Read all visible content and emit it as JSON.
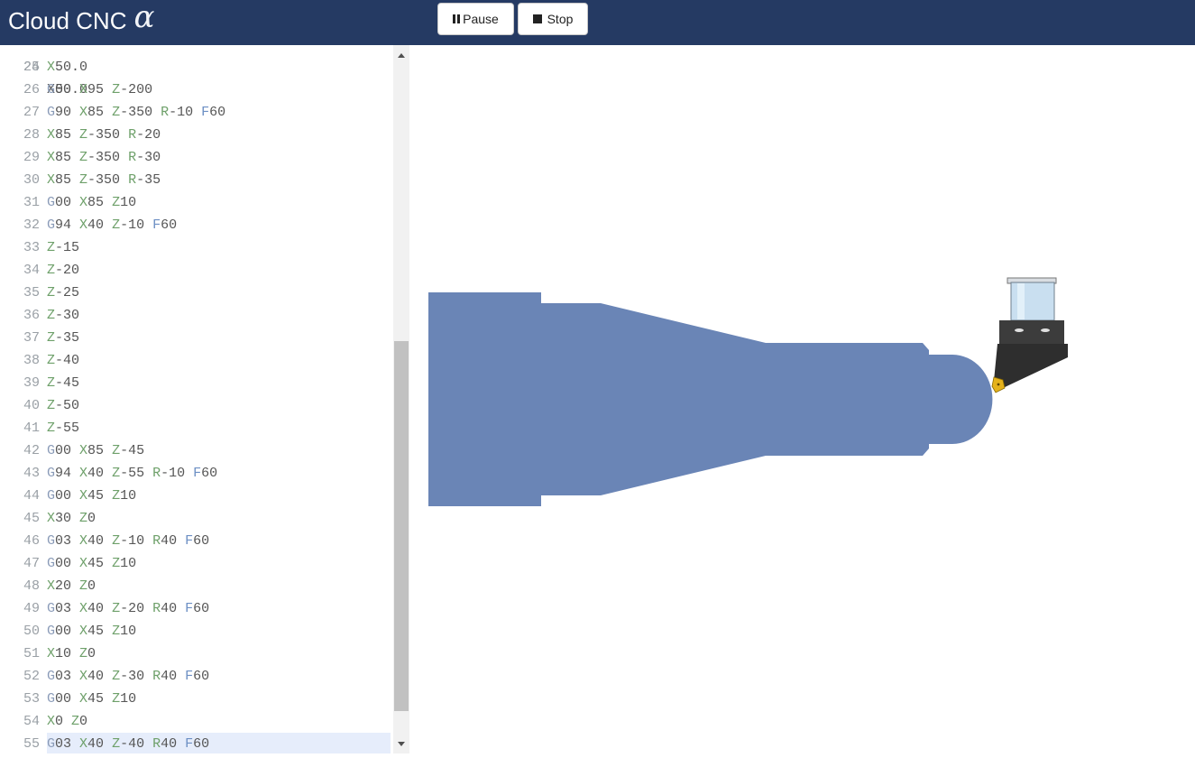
{
  "app": {
    "title": "Cloud CNC",
    "title_glyph": "α",
    "pause_label": "Pause",
    "stop_label": "Stop",
    "pause_icon": "pause-icon",
    "stop_icon": "stop-icon"
  },
  "colors": {
    "topbar": "#253a63",
    "workpiece": "#6a85b6",
    "active_line": "#e6edfb",
    "insert": "#e5b21c"
  },
  "editor": {
    "partial_top_line": {
      "num": "24",
      "text": "X50.0"
    },
    "active_line": "55",
    "lines": [
      {
        "num": "25",
        "tokens": [
          {
            "t": "X",
            "c": "x"
          },
          {
            "t": "50.0",
            "c": "n"
          }
        ]
      },
      {
        "num": "26",
        "tokens": [
          {
            "t": "G",
            "c": "g"
          },
          {
            "t": "00 ",
            "c": "n"
          },
          {
            "t": "X",
            "c": "x"
          },
          {
            "t": "95 ",
            "c": "n"
          },
          {
            "t": "Z",
            "c": "z"
          },
          {
            "t": "-200",
            "c": "n"
          }
        ]
      },
      {
        "num": "27",
        "tokens": [
          {
            "t": "G",
            "c": "g"
          },
          {
            "t": "90 ",
            "c": "n"
          },
          {
            "t": "X",
            "c": "x"
          },
          {
            "t": "85 ",
            "c": "n"
          },
          {
            "t": "Z",
            "c": "z"
          },
          {
            "t": "-350 ",
            "c": "n"
          },
          {
            "t": "R",
            "c": "r"
          },
          {
            "t": "-10 ",
            "c": "n"
          },
          {
            "t": "F",
            "c": "f"
          },
          {
            "t": "60",
            "c": "n"
          }
        ]
      },
      {
        "num": "28",
        "tokens": [
          {
            "t": "X",
            "c": "x"
          },
          {
            "t": "85 ",
            "c": "n"
          },
          {
            "t": "Z",
            "c": "z"
          },
          {
            "t": "-350 ",
            "c": "n"
          },
          {
            "t": "R",
            "c": "r"
          },
          {
            "t": "-20",
            "c": "n"
          }
        ]
      },
      {
        "num": "29",
        "tokens": [
          {
            "t": "X",
            "c": "x"
          },
          {
            "t": "85 ",
            "c": "n"
          },
          {
            "t": "Z",
            "c": "z"
          },
          {
            "t": "-350 ",
            "c": "n"
          },
          {
            "t": "R",
            "c": "r"
          },
          {
            "t": "-30",
            "c": "n"
          }
        ]
      },
      {
        "num": "30",
        "tokens": [
          {
            "t": "X",
            "c": "x"
          },
          {
            "t": "85 ",
            "c": "n"
          },
          {
            "t": "Z",
            "c": "z"
          },
          {
            "t": "-350 ",
            "c": "n"
          },
          {
            "t": "R",
            "c": "r"
          },
          {
            "t": "-35",
            "c": "n"
          }
        ]
      },
      {
        "num": "31",
        "tokens": [
          {
            "t": "G",
            "c": "g"
          },
          {
            "t": "00 ",
            "c": "n"
          },
          {
            "t": "X",
            "c": "x"
          },
          {
            "t": "85 ",
            "c": "n"
          },
          {
            "t": "Z",
            "c": "z"
          },
          {
            "t": "10",
            "c": "n"
          }
        ]
      },
      {
        "num": "32",
        "tokens": [
          {
            "t": "G",
            "c": "g"
          },
          {
            "t": "94 ",
            "c": "n"
          },
          {
            "t": "X",
            "c": "x"
          },
          {
            "t": "40 ",
            "c": "n"
          },
          {
            "t": "Z",
            "c": "z"
          },
          {
            "t": "-10 ",
            "c": "n"
          },
          {
            "t": "F",
            "c": "f"
          },
          {
            "t": "60",
            "c": "n"
          }
        ]
      },
      {
        "num": "33",
        "tokens": [
          {
            "t": "Z",
            "c": "z"
          },
          {
            "t": "-15",
            "c": "n"
          }
        ]
      },
      {
        "num": "34",
        "tokens": [
          {
            "t": "Z",
            "c": "z"
          },
          {
            "t": "-20",
            "c": "n"
          }
        ]
      },
      {
        "num": "35",
        "tokens": [
          {
            "t": "Z",
            "c": "z"
          },
          {
            "t": "-25",
            "c": "n"
          }
        ]
      },
      {
        "num": "36",
        "tokens": [
          {
            "t": "Z",
            "c": "z"
          },
          {
            "t": "-30",
            "c": "n"
          }
        ]
      },
      {
        "num": "37",
        "tokens": [
          {
            "t": "Z",
            "c": "z"
          },
          {
            "t": "-35",
            "c": "n"
          }
        ]
      },
      {
        "num": "38",
        "tokens": [
          {
            "t": "Z",
            "c": "z"
          },
          {
            "t": "-40",
            "c": "n"
          }
        ]
      },
      {
        "num": "39",
        "tokens": [
          {
            "t": "Z",
            "c": "z"
          },
          {
            "t": "-45",
            "c": "n"
          }
        ]
      },
      {
        "num": "40",
        "tokens": [
          {
            "t": "Z",
            "c": "z"
          },
          {
            "t": "-50",
            "c": "n"
          }
        ]
      },
      {
        "num": "41",
        "tokens": [
          {
            "t": "Z",
            "c": "z"
          },
          {
            "t": "-55",
            "c": "n"
          }
        ]
      },
      {
        "num": "42",
        "tokens": [
          {
            "t": "G",
            "c": "g"
          },
          {
            "t": "00 ",
            "c": "n"
          },
          {
            "t": "X",
            "c": "x"
          },
          {
            "t": "85 ",
            "c": "n"
          },
          {
            "t": "Z",
            "c": "z"
          },
          {
            "t": "-45",
            "c": "n"
          }
        ]
      },
      {
        "num": "43",
        "tokens": [
          {
            "t": "G",
            "c": "g"
          },
          {
            "t": "94 ",
            "c": "n"
          },
          {
            "t": "X",
            "c": "x"
          },
          {
            "t": "40 ",
            "c": "n"
          },
          {
            "t": "Z",
            "c": "z"
          },
          {
            "t": "-55 ",
            "c": "n"
          },
          {
            "t": "R",
            "c": "r"
          },
          {
            "t": "-10 ",
            "c": "n"
          },
          {
            "t": "F",
            "c": "f"
          },
          {
            "t": "60",
            "c": "n"
          }
        ]
      },
      {
        "num": "44",
        "tokens": [
          {
            "t": "G",
            "c": "g"
          },
          {
            "t": "00 ",
            "c": "n"
          },
          {
            "t": "X",
            "c": "x"
          },
          {
            "t": "45 ",
            "c": "n"
          },
          {
            "t": "Z",
            "c": "z"
          },
          {
            "t": "10",
            "c": "n"
          }
        ]
      },
      {
        "num": "45",
        "tokens": [
          {
            "t": "X",
            "c": "x"
          },
          {
            "t": "30 ",
            "c": "n"
          },
          {
            "t": "Z",
            "c": "z"
          },
          {
            "t": "0",
            "c": "n"
          }
        ]
      },
      {
        "num": "46",
        "tokens": [
          {
            "t": "G",
            "c": "g"
          },
          {
            "t": "03 ",
            "c": "n"
          },
          {
            "t": "X",
            "c": "x"
          },
          {
            "t": "40 ",
            "c": "n"
          },
          {
            "t": "Z",
            "c": "z"
          },
          {
            "t": "-10 ",
            "c": "n"
          },
          {
            "t": "R",
            "c": "r"
          },
          {
            "t": "40 ",
            "c": "n"
          },
          {
            "t": "F",
            "c": "f"
          },
          {
            "t": "60",
            "c": "n"
          }
        ]
      },
      {
        "num": "47",
        "tokens": [
          {
            "t": "G",
            "c": "g"
          },
          {
            "t": "00 ",
            "c": "n"
          },
          {
            "t": "X",
            "c": "x"
          },
          {
            "t": "45 ",
            "c": "n"
          },
          {
            "t": "Z",
            "c": "z"
          },
          {
            "t": "10",
            "c": "n"
          }
        ]
      },
      {
        "num": "48",
        "tokens": [
          {
            "t": "X",
            "c": "x"
          },
          {
            "t": "20 ",
            "c": "n"
          },
          {
            "t": "Z",
            "c": "z"
          },
          {
            "t": "0",
            "c": "n"
          }
        ]
      },
      {
        "num": "49",
        "tokens": [
          {
            "t": "G",
            "c": "g"
          },
          {
            "t": "03 ",
            "c": "n"
          },
          {
            "t": "X",
            "c": "x"
          },
          {
            "t": "40 ",
            "c": "n"
          },
          {
            "t": "Z",
            "c": "z"
          },
          {
            "t": "-20 ",
            "c": "n"
          },
          {
            "t": "R",
            "c": "r"
          },
          {
            "t": "40 ",
            "c": "n"
          },
          {
            "t": "F",
            "c": "f"
          },
          {
            "t": "60",
            "c": "n"
          }
        ]
      },
      {
        "num": "50",
        "tokens": [
          {
            "t": "G",
            "c": "g"
          },
          {
            "t": "00 ",
            "c": "n"
          },
          {
            "t": "X",
            "c": "x"
          },
          {
            "t": "45 ",
            "c": "n"
          },
          {
            "t": "Z",
            "c": "z"
          },
          {
            "t": "10",
            "c": "n"
          }
        ]
      },
      {
        "num": "51",
        "tokens": [
          {
            "t": "X",
            "c": "x"
          },
          {
            "t": "10 ",
            "c": "n"
          },
          {
            "t": "Z",
            "c": "z"
          },
          {
            "t": "0",
            "c": "n"
          }
        ]
      },
      {
        "num": "52",
        "tokens": [
          {
            "t": "G",
            "c": "g"
          },
          {
            "t": "03 ",
            "c": "n"
          },
          {
            "t": "X",
            "c": "x"
          },
          {
            "t": "40 ",
            "c": "n"
          },
          {
            "t": "Z",
            "c": "z"
          },
          {
            "t": "-30 ",
            "c": "n"
          },
          {
            "t": "R",
            "c": "r"
          },
          {
            "t": "40 ",
            "c": "n"
          },
          {
            "t": "F",
            "c": "f"
          },
          {
            "t": "60",
            "c": "n"
          }
        ]
      },
      {
        "num": "53",
        "tokens": [
          {
            "t": "G",
            "c": "g"
          },
          {
            "t": "00 ",
            "c": "n"
          },
          {
            "t": "X",
            "c": "x"
          },
          {
            "t": "45 ",
            "c": "n"
          },
          {
            "t": "Z",
            "c": "z"
          },
          {
            "t": "10",
            "c": "n"
          }
        ]
      },
      {
        "num": "54",
        "tokens": [
          {
            "t": "X",
            "c": "x"
          },
          {
            "t": "0 ",
            "c": "n"
          },
          {
            "t": "Z",
            "c": "z"
          },
          {
            "t": "0",
            "c": "n"
          }
        ]
      },
      {
        "num": "55",
        "tokens": [
          {
            "t": "G",
            "c": "g"
          },
          {
            "t": "03 ",
            "c": "n"
          },
          {
            "t": "X",
            "c": "x"
          },
          {
            "t": "40 ",
            "c": "n"
          },
          {
            "t": "Z",
            "c": "z"
          },
          {
            "t": "-40 ",
            "c": "n"
          },
          {
            "t": "R",
            "c": "r"
          },
          {
            "t": "40 ",
            "c": "n"
          },
          {
            "t": "F",
            "c": "f"
          },
          {
            "t": "60",
            "c": "n"
          }
        ]
      }
    ]
  }
}
